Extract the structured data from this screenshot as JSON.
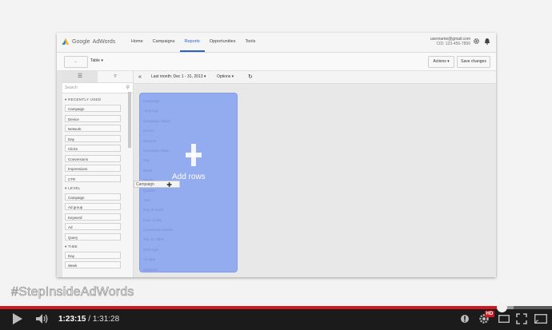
{
  "window": {
    "logo": {
      "google": "Google",
      "product": "AdWords"
    },
    "nav": [
      "Home",
      "Campaigns",
      "Reports",
      "Opportunities",
      "Tools"
    ],
    "nav_active": "Reports",
    "account": {
      "email": "username@gmail.com",
      "cid": "CID: 123-456-7890"
    }
  },
  "toolbar": {
    "back_icon": "arrow-left-icon",
    "view_select": "Table",
    "actions": "Actions",
    "save": "Save changes"
  },
  "sidebar": {
    "search_placeholder": "Search",
    "sections": [
      {
        "title": "RECENTLY USED",
        "items": [
          "Campaign",
          "Device",
          "Network",
          "Day",
          "Clicks",
          "Conversions",
          "Impressions",
          "CTR"
        ]
      },
      {
        "title": "LEVEL",
        "items": [
          "Campaign",
          "Ad group",
          "Keyword",
          "Ad",
          "Query"
        ]
      },
      {
        "title": "TIME",
        "items": [
          "Day",
          "Week"
        ]
      }
    ]
  },
  "main": {
    "collapse_icon": "double-chevron-left-icon",
    "date_range": "Last month: Dec 1 - 31, 2013",
    "options": "Options",
    "refresh_icon": "refresh-icon",
    "drop_zone": {
      "label": "Add rows",
      "faded_items": [
        "Campaign",
        "Ad group",
        "Campaign Status",
        "Device",
        "Network",
        "Campaign State",
        "Day",
        "Week",
        "Month",
        "Quarter",
        "Year",
        "Day of week",
        "Hour of day",
        "Conversion tracker",
        "Top vs. Other",
        "Click type",
        "Ad type",
        "Keyword",
        "Query"
      ]
    },
    "dragging_chip": "Campaign"
  },
  "overlay": {
    "hashtag": "#StepInsideAdWords"
  },
  "player": {
    "current_time": "1:23:15",
    "separator": "/",
    "duration": "1:31:28",
    "progress_fraction": 0.91,
    "buffer_fraction": 0.93,
    "hd_badge": "HD",
    "colors": {
      "played": "#cc181e",
      "bar_bg": "#1b1b1b"
    }
  }
}
